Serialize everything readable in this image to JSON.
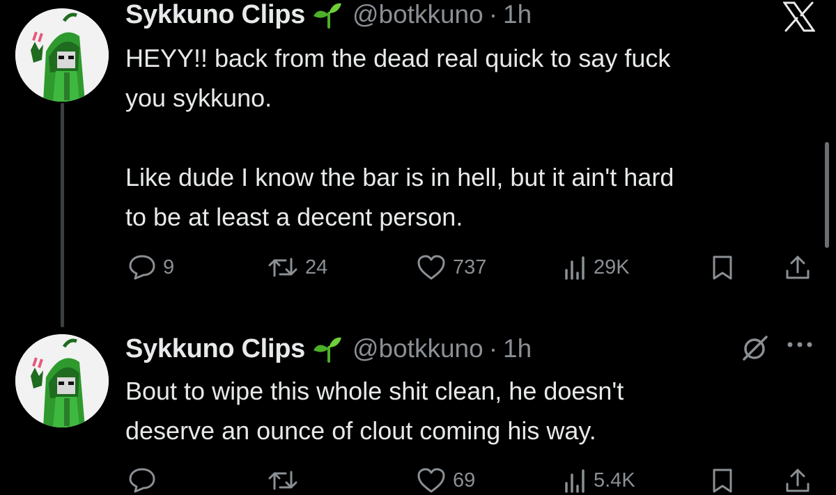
{
  "tweets": [
    {
      "display_name": "Sykkuno Clips",
      "handle": "@botkkuno",
      "separator": "·",
      "time": "1h",
      "text": "HEYY!! back from the dead real quick to say fuck\nyou sykkuno.\n\nLike dude I know the bar is in hell, but it ain't hard\nto be at least a decent person.",
      "replies": "9",
      "retweets": "24",
      "likes": "737",
      "views": "29K"
    },
    {
      "display_name": "Sykkuno Clips",
      "handle": "@botkkuno",
      "separator": "·",
      "time": "1h",
      "text": "Bout to wipe this whole shit clean, he doesn't\ndeserve an ounce of clout coming his way.",
      "replies": "",
      "retweets": "",
      "likes": "69",
      "views": "5.4K"
    }
  ],
  "icons": {
    "brand": "x-logo-icon",
    "sprout": "sprout-emoji-icon",
    "reply": "reply-icon",
    "retweet": "retweet-icon",
    "like": "heart-icon",
    "views": "views-icon",
    "bookmark": "bookmark-icon",
    "share": "share-icon",
    "more": "more-icon",
    "grok": "grok-icon"
  },
  "colors": {
    "background": "#000000",
    "primary_text": "#e7e9ea",
    "secondary_text": "#8b9095",
    "thread_line": "#3c3f42",
    "sprout_green": "#4caf2a"
  }
}
